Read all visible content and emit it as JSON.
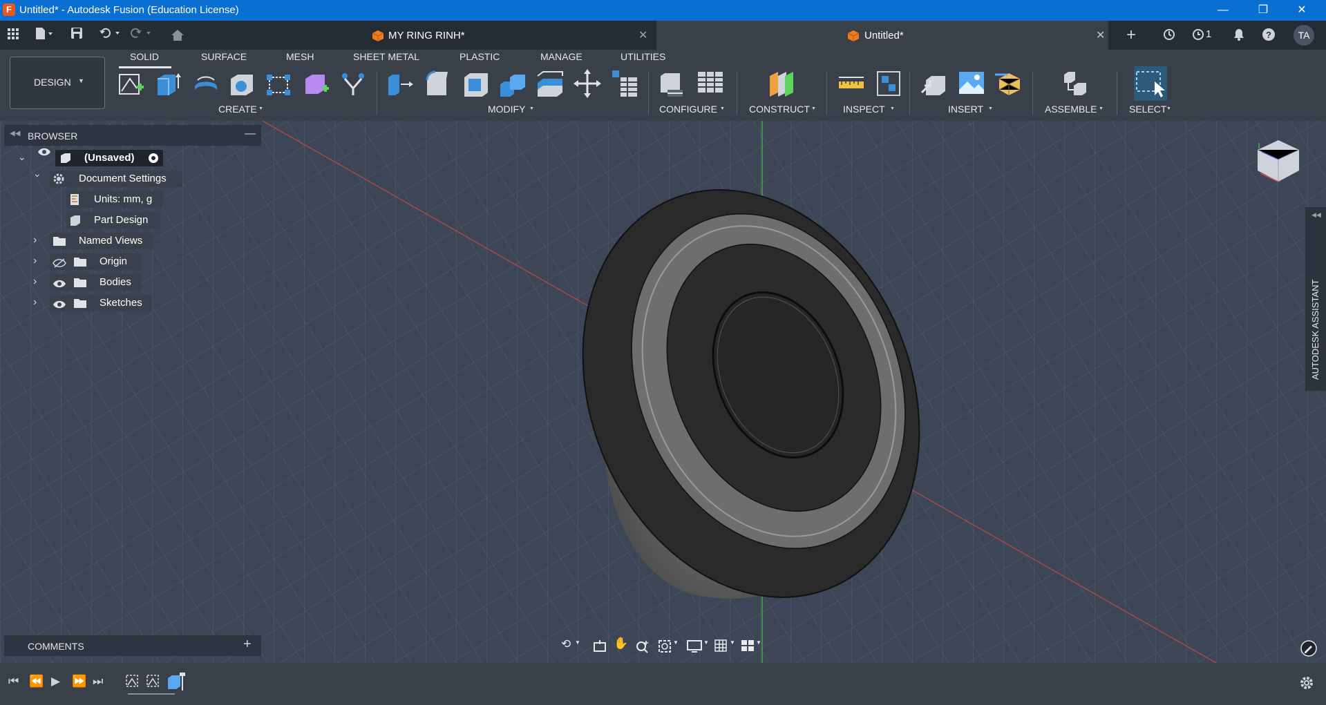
{
  "window": {
    "title": "Untitled* - Autodesk Fusion (Education License)"
  },
  "tabs": [
    {
      "label": "MY RING RINH*"
    },
    {
      "label": "Untitled*"
    }
  ],
  "header_right": {
    "job_count": "1",
    "user_initials": "TA"
  },
  "toolbar": {
    "workspace_label": "DESIGN",
    "tabs": [
      "SOLID",
      "SURFACE",
      "MESH",
      "SHEET METAL",
      "PLASTIC",
      "MANAGE",
      "UTILITIES"
    ],
    "active_tab": "SOLID",
    "groups": [
      "CREATE",
      "MODIFY",
      "CONFIGURE",
      "CONSTRUCT",
      "INSPECT",
      "INSERT",
      "ASSEMBLE",
      "SELECT"
    ]
  },
  "browser": {
    "title": "BROWSER",
    "root": "(Unsaved)",
    "document_settings": "Document Settings",
    "units": "Units: mm, g",
    "part_design": "Part Design",
    "named_views": "Named Views",
    "origin": "Origin",
    "bodies": "Bodies",
    "sketches": "Sketches"
  },
  "comments": {
    "title": "COMMENTS"
  },
  "assistant": {
    "label": "AUTODESK ASSISTANT"
  },
  "colors": {
    "title_bar": "#0a6fd2",
    "toolbar": "#39404a",
    "viewport": "#3c4656",
    "accent_orange": "#f07c1e",
    "body_dark": "#2b2b2b",
    "body_gray": "#6e6e6e"
  },
  "icons": [
    "grid-icon",
    "file-icon",
    "save-icon",
    "undo-icon",
    "redo-icon",
    "home-icon",
    "plus-icon",
    "refresh-icon",
    "clock-icon",
    "bell-icon",
    "help-icon",
    "gear-icon"
  ]
}
